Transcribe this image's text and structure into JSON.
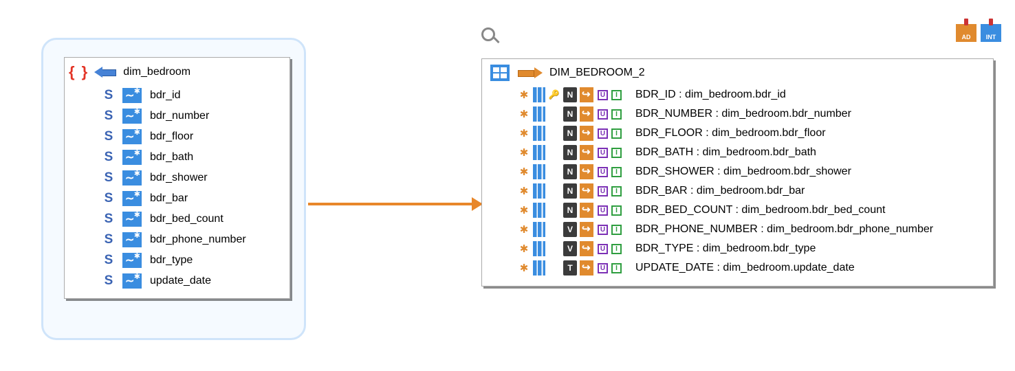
{
  "source": {
    "title": "dim_bedroom",
    "fields": [
      "bdr_id",
      "bdr_number",
      "bdr_floor",
      "bdr_bath",
      "bdr_shower",
      "bdr_bar",
      "bdr_bed_count",
      "bdr_phone_number",
      "bdr_type",
      "update_date"
    ]
  },
  "target": {
    "title": "DIM_BEDROOM_2",
    "columns": [
      {
        "label": "BDR_ID : dim_bedroom.bdr_id",
        "type": "N",
        "key": true
      },
      {
        "label": "BDR_NUMBER : dim_bedroom.bdr_number",
        "type": "N",
        "key": false
      },
      {
        "label": "BDR_FLOOR : dim_bedroom.bdr_floor",
        "type": "N",
        "key": false
      },
      {
        "label": "BDR_BATH : dim_bedroom.bdr_bath",
        "type": "N",
        "key": false
      },
      {
        "label": "BDR_SHOWER : dim_bedroom.bdr_shower",
        "type": "N",
        "key": false
      },
      {
        "label": "BDR_BAR : dim_bedroom.bdr_bar",
        "type": "N",
        "key": false
      },
      {
        "label": "BDR_BED_COUNT : dim_bedroom.bdr_bed_count",
        "type": "N",
        "key": false
      },
      {
        "label": "BDR_PHONE_NUMBER : dim_bedroom.bdr_phone_number",
        "type": "V",
        "key": false
      },
      {
        "label": "BDR_TYPE : dim_bedroom.bdr_type",
        "type": "V",
        "key": false
      },
      {
        "label": "UPDATE_DATE : dim_bedroom.update_date",
        "type": "T",
        "key": false
      }
    ]
  },
  "top_icons": {
    "a": "AD",
    "b": "INT"
  }
}
